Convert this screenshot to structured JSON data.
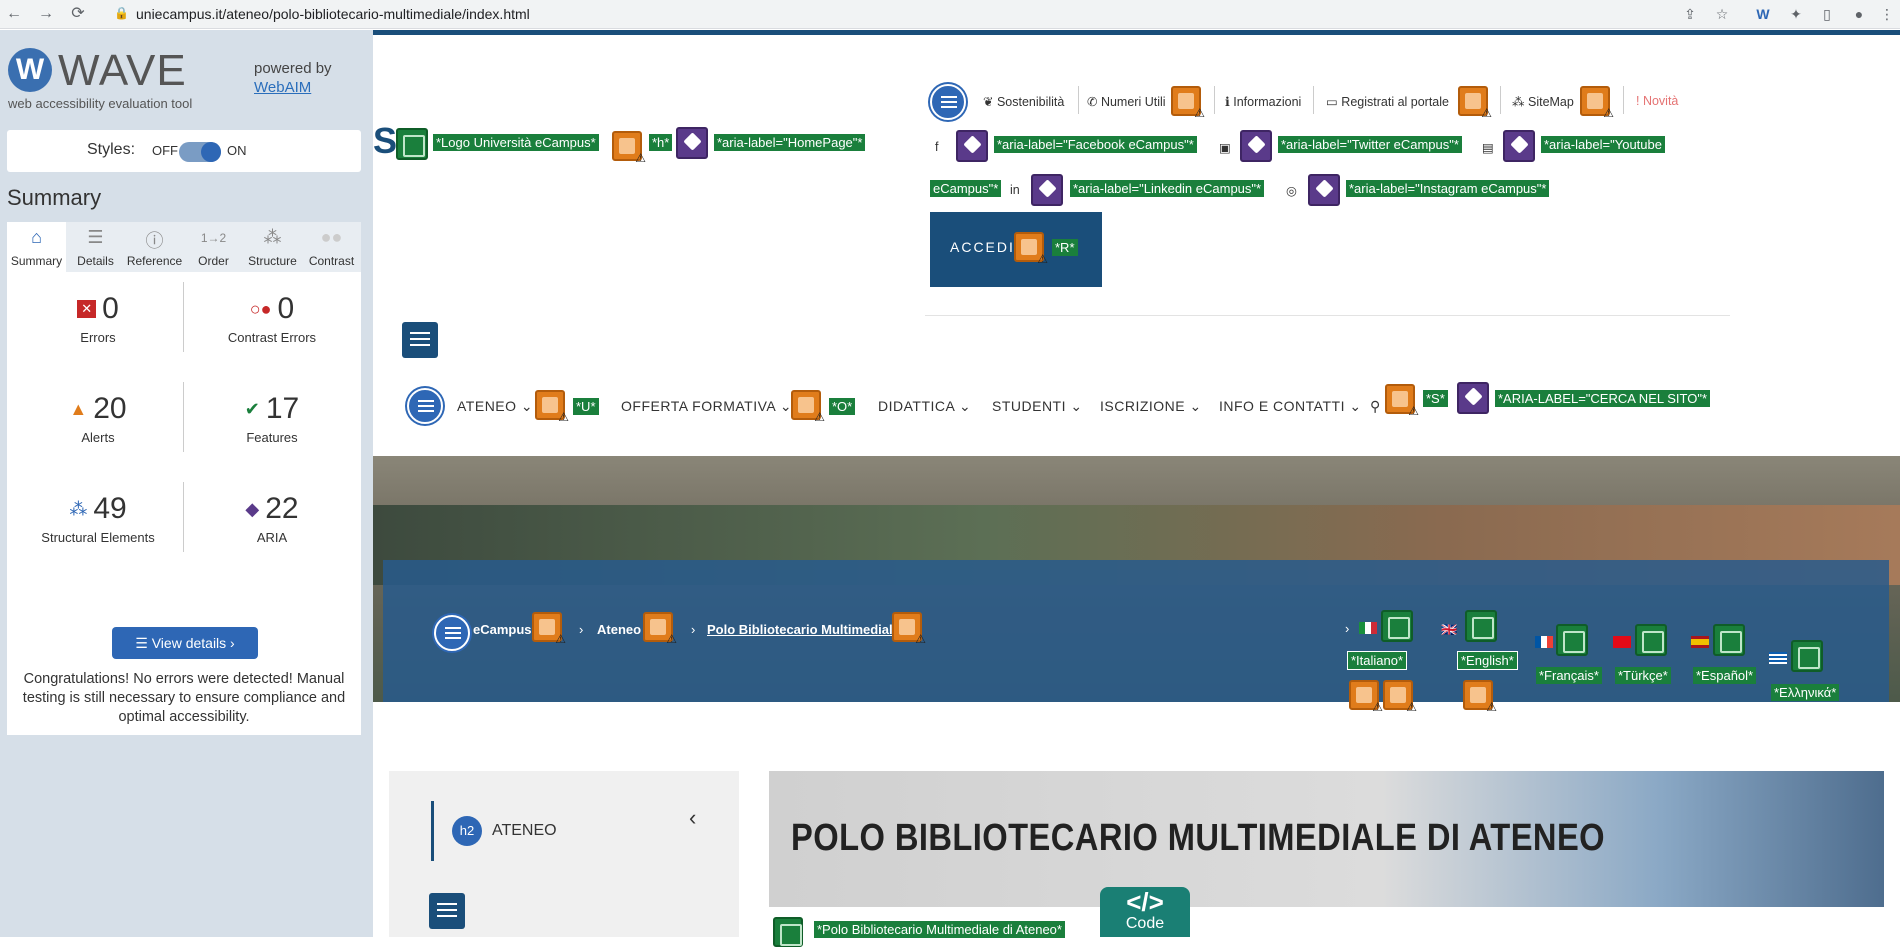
{
  "browser": {
    "url": "uniecampus.it/ateneo/polo-bibliotecario-multimediale/index.html"
  },
  "wave": {
    "title": "WAVE",
    "subtitle": "web accessibility evaluation tool",
    "powered_by": "powered by",
    "webaim": "WebAIM",
    "styles_label": "Styles:",
    "styles_off": "OFF",
    "styles_on": "ON",
    "summary_heading": "Summary",
    "tabs": [
      {
        "label": "Summary",
        "icon": "home-icon"
      },
      {
        "label": "Details",
        "icon": "list-icon"
      },
      {
        "label": "Reference",
        "icon": "info-icon"
      },
      {
        "label": "Order",
        "icon": "order-icon"
      },
      {
        "label": "Structure",
        "icon": "structure-icon"
      },
      {
        "label": "Contrast",
        "icon": "contrast-icon"
      }
    ],
    "stats": {
      "errors": {
        "value": "0",
        "label": "Errors"
      },
      "contrast_errors": {
        "value": "0",
        "label": "Contrast Errors"
      },
      "alerts": {
        "value": "20",
        "label": "Alerts"
      },
      "features": {
        "value": "17",
        "label": "Features"
      },
      "structural": {
        "value": "49",
        "label": "Structural Elements"
      },
      "aria": {
        "value": "22",
        "label": "ARIA"
      }
    },
    "view_details": "View details ›",
    "congrats": "Congratulations! No errors were detected! Manual testing is still necessary to ensure compliance and optimal accessibility."
  },
  "site": {
    "util_links": {
      "sostenibilita": "Sostenibilità",
      "numeri_utili": "Numeri Utili",
      "informazioni": "Informazioni",
      "registrati": "Registrati al portale",
      "sitemap": "SiteMap",
      "novita": "Novità"
    },
    "labels": {
      "logo": "*Logo Università eCampus*",
      "h": "*h*",
      "homepage": "*aria-label=\"HomePage\"*",
      "facebook": "*aria-label=\"Facebook eCampus\"*",
      "twitter": "*aria-label=\"Twitter eCampus\"*",
      "youtube_1": "*aria-label=\"Youtube",
      "youtube_2": "eCampus\"*",
      "linkedin": "*aria-label=\"Linkedin eCampus\"*",
      "instagram": "*aria-label=\"Instagram eCampus\"*",
      "r": "*R*",
      "u": "*U*",
      "o": "*O*",
      "s": "*S*",
      "cerca": "*ARIA-LABEL=\"CERCA NEL SITO\"*",
      "italiano": "*Italiano*",
      "english": "*English*",
      "francais": "*Français*",
      "turkce": "*Türkçe*",
      "espanol": "*Español*",
      "ellinika": "*Ελληνικά*",
      "polo_alt": "*Polo Bibliotecario Multimediale di Ateneo*"
    },
    "accedi": "ACCEDI",
    "nav": [
      "ATENEO",
      "OFFERTA FORMATIVA",
      "DIDATTICA",
      "STUDENTI",
      "ISCRIZIONE",
      "INFO E CONTATTI"
    ],
    "breadcrumb": [
      "eCampus",
      "Ateneo",
      "Polo Bibliotecario Multimediale"
    ],
    "side_heading": "ATENEO",
    "h2_badge": "h2",
    "banner_title": "POLO BIBLIOTECARIO MULTIMEDIALE DI ATENEO",
    "code_tab": "Code",
    "code_glyph": "</>",
    "logo_letter": "S"
  }
}
